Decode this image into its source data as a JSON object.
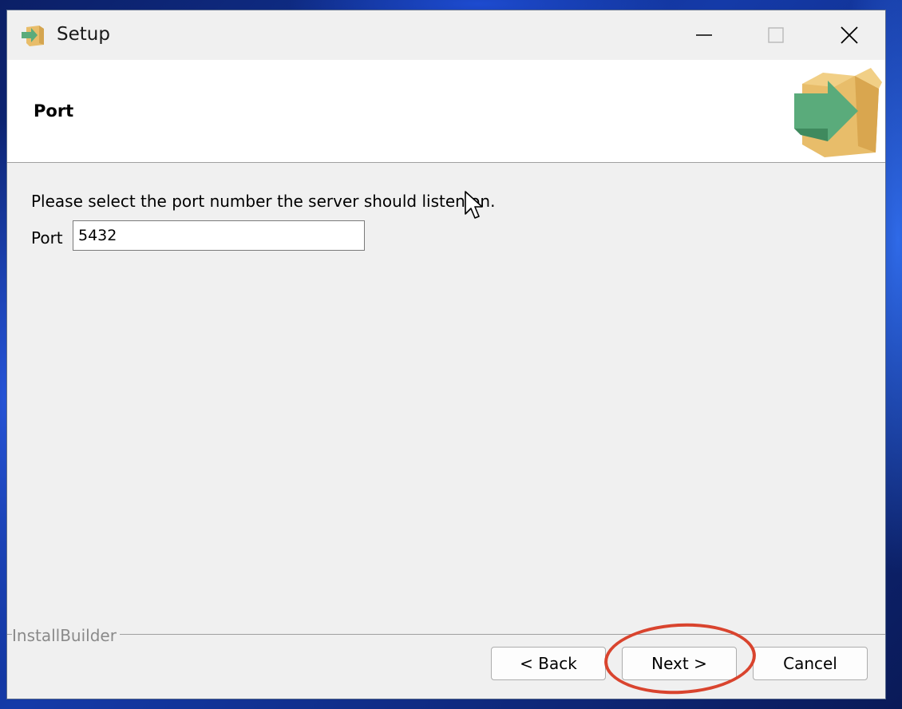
{
  "window": {
    "title": "Setup",
    "controls": {
      "minimize": "minimize",
      "maximize": "maximize",
      "close": "close"
    }
  },
  "header": {
    "title": "Port",
    "logo_icon": "installer-box-arrow-icon"
  },
  "content": {
    "instruction": "Please select the port number the server should listen on.",
    "port_label": "Port",
    "port_value": "5432"
  },
  "footer": {
    "brand": "InstallBuilder",
    "back_label": "< Back",
    "next_label": "Next >",
    "cancel_label": "Cancel"
  },
  "colors": {
    "highlight_ring": "#d9442e",
    "box": "#e8bd6a",
    "arrow": "#5aab7b"
  }
}
